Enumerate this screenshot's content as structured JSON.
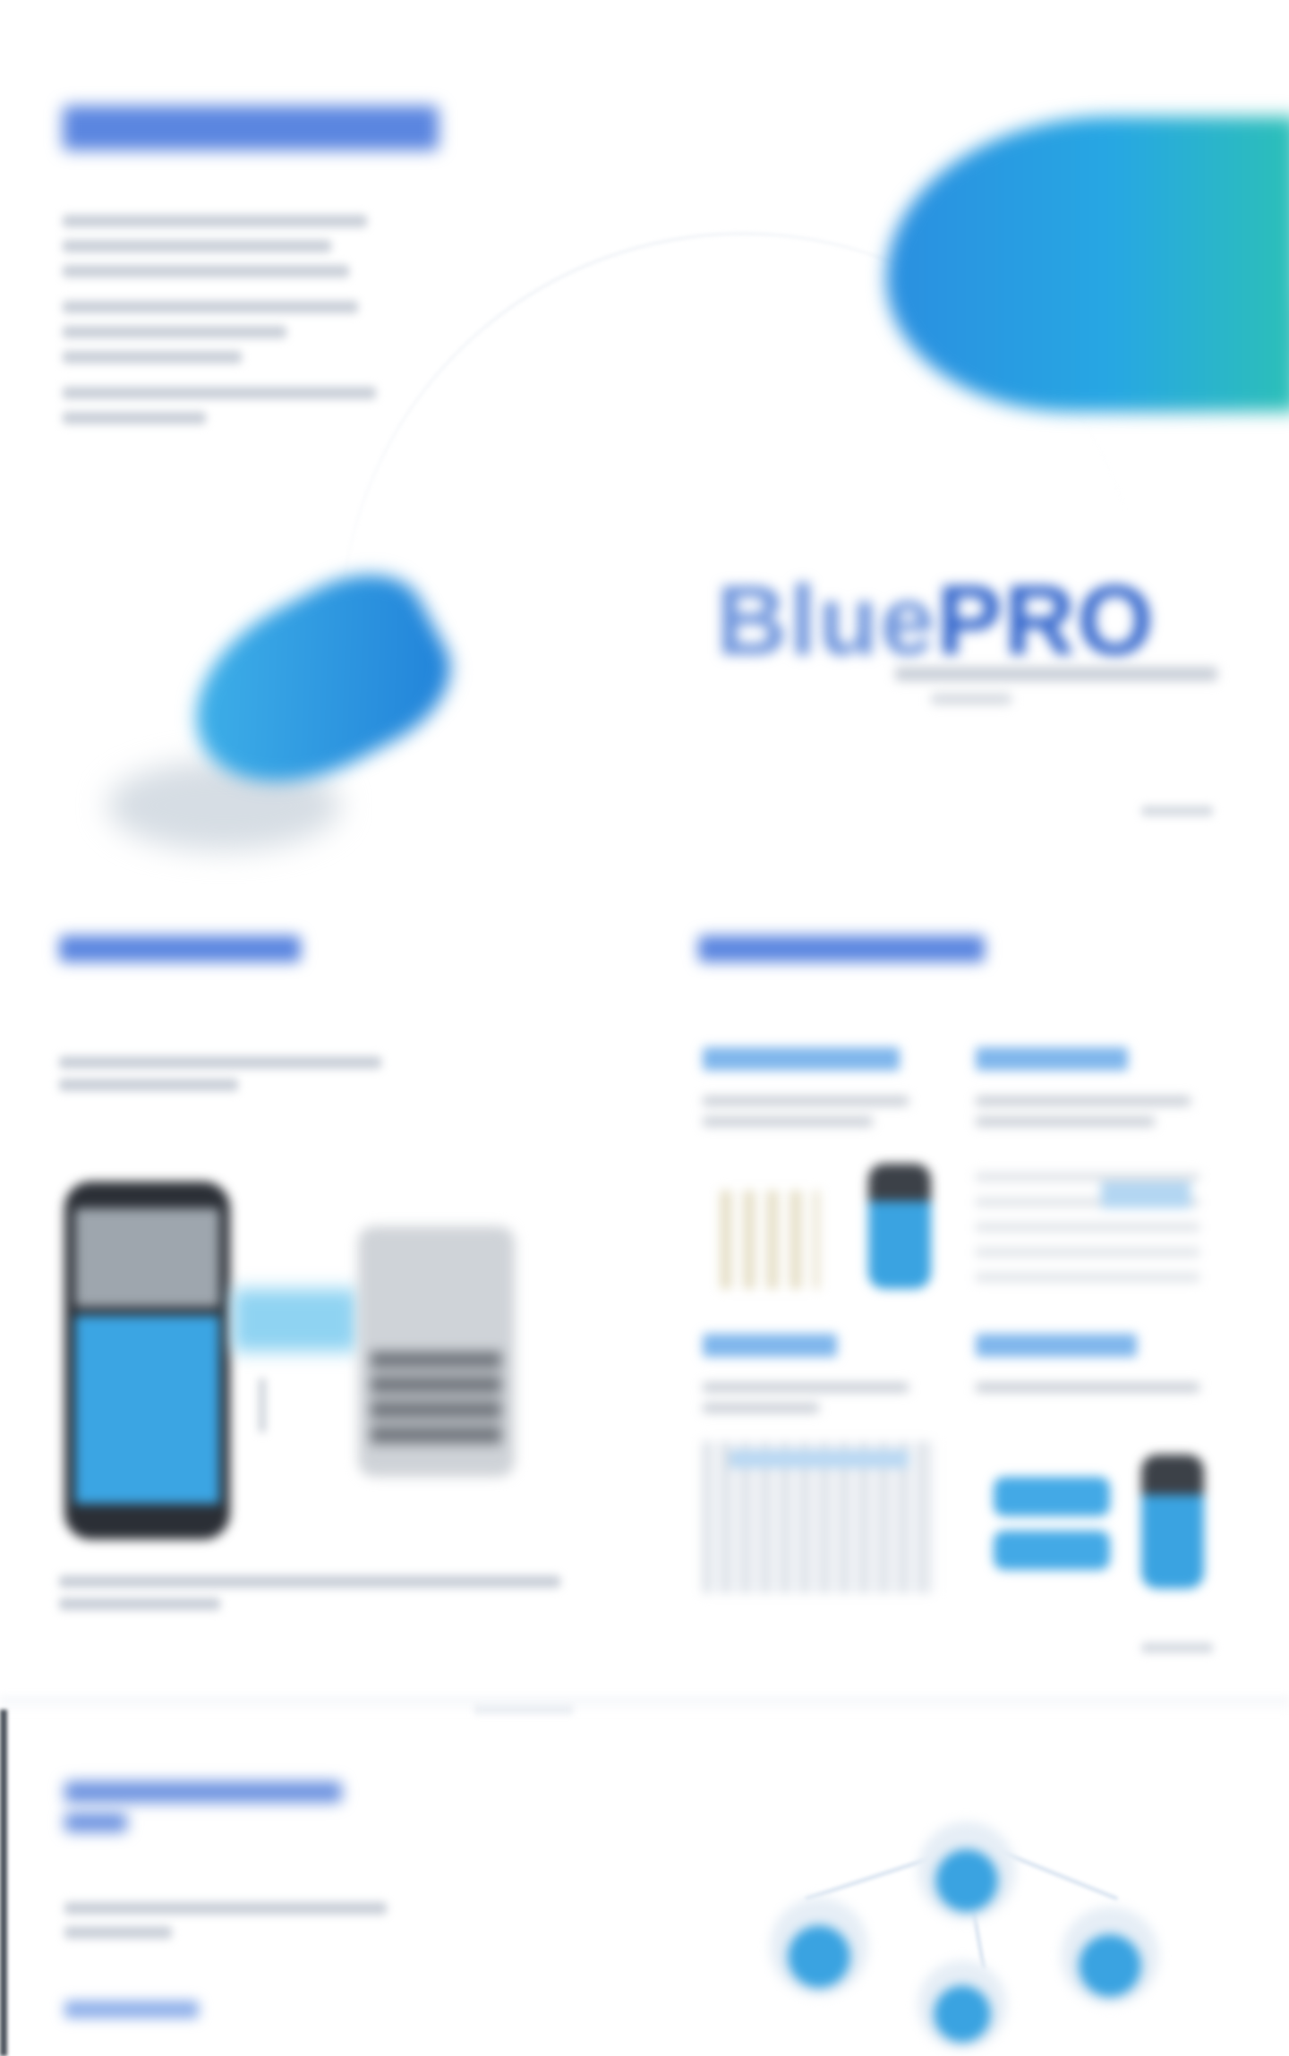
{
  "section_top": {
    "heading": "",
    "paragraph_lines": [
      "",
      "",
      "",
      "",
      "",
      "",
      "",
      ""
    ]
  },
  "logo": {
    "light_part": "Blue",
    "dark_part": "PRO",
    "tagline": ""
  },
  "left_panel": {
    "heading": "",
    "intro": "",
    "caption": ""
  },
  "right_panel": {
    "heading": ""
  },
  "bottom_section": {
    "heading": "",
    "paragraph": "",
    "subheading": ""
  },
  "colors": {
    "accent_blue": "#3b6fd6",
    "brand_cyan": "#27a7e3",
    "brand_teal": "#2cc0b7"
  }
}
